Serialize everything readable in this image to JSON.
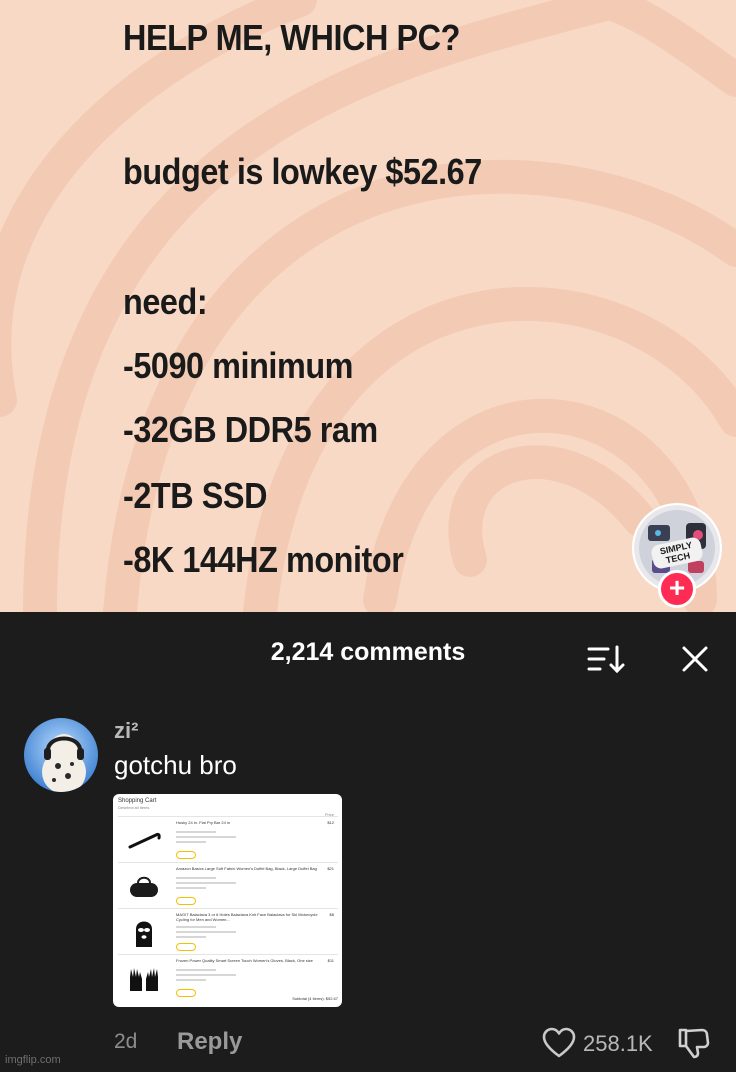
{
  "post": {
    "lines": [
      "HELP ME, WHICH PC?",
      "budget is lowkey $52.67",
      "need:",
      "-5090 minimum",
      "-32GB DDR5 ram",
      "-2TB SSD",
      "-8K 144HZ monitor"
    ],
    "creator_badge": "SIMPLY TECH",
    "follow_symbol": "+"
  },
  "comments_sheet": {
    "title": "2,214 comments",
    "sort_icon": "sort-icon",
    "close_icon": "close-icon"
  },
  "comment": {
    "username": "zi²",
    "text": "gotchu bro",
    "time": "2d",
    "reply_label": "Reply",
    "like_count": "258.1K",
    "attachment": {
      "title": "Shopping Cart",
      "subtitle": "Deselect all items",
      "price_header": "Price",
      "items": [
        {
          "name": "Husky 24 in. Flat Pry Bar 24 in",
          "price": "$12",
          "icon": "crowbar"
        },
        {
          "name": "Amazon Basics Large Soft Fabric Women's Duffel Bag, Black, Large Duffel Bag",
          "price": "$21",
          "icon": "duffel-bag"
        },
        {
          "name": "MAGIT Balaclava 3 or 6 Holes Balaclava Knit Face Balaclava for Ski Motorcycle Cycling for Men and Women...",
          "price": "$8",
          "icon": "ski-mask"
        },
        {
          "name": "Frozen Power Quality Smart Screen Touch Women's Gloves, Black, One size",
          "price": "$11",
          "icon": "gloves"
        }
      ],
      "subtotal": "Subtotal (4 items): $52.67"
    }
  },
  "colors": {
    "background_peach": "#f8d9c6",
    "sheet_dark": "#1c1c1c",
    "accent_red": "#fe2c55"
  },
  "watermark": "imgflip.com"
}
